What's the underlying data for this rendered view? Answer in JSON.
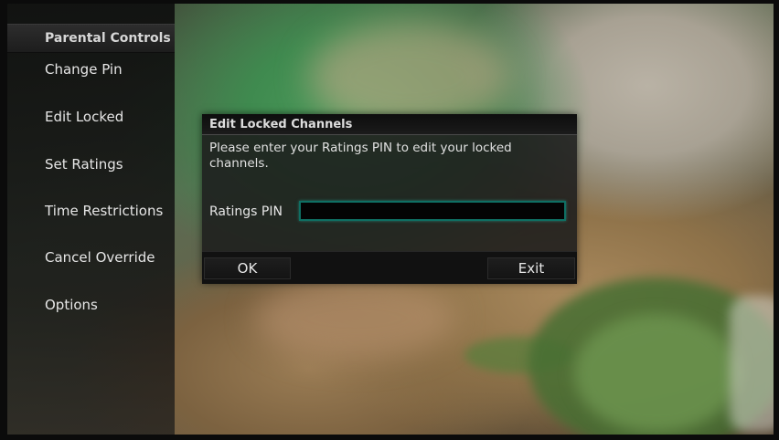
{
  "menu": {
    "title": "Parental Controls",
    "items": [
      {
        "label": "Change Pin"
      },
      {
        "label": "Edit Locked"
      },
      {
        "label": "Set Ratings"
      },
      {
        "label": "Time Restrictions"
      },
      {
        "label": "Cancel Override"
      },
      {
        "label": "Options"
      }
    ]
  },
  "dialog": {
    "title": "Edit Locked Channels",
    "message": "Please enter your Ratings PIN to edit your locked channels.",
    "pin_label": "Ratings PIN",
    "pin_value": "",
    "ok_label": "OK",
    "exit_label": "Exit"
  },
  "colors": {
    "input_focus_border": "#0f6f63",
    "panel_background": "#1c1c1c"
  }
}
